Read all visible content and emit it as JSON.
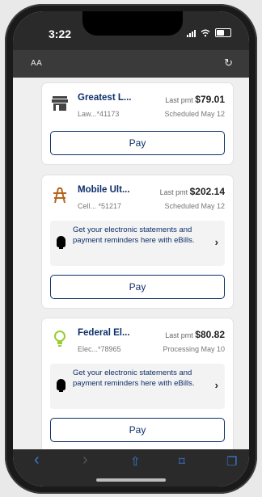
{
  "status": {
    "time": "3:22"
  },
  "browser": {
    "text_size_label": "AA",
    "reload_icon": "↻"
  },
  "colors": {
    "brand": "#0e2f6b",
    "accent": "#1a73e8"
  },
  "bills": [
    {
      "name": "Greatest L...",
      "account": "Law...*41173",
      "last_pmt_label": "Last pmt",
      "amount": "$79.01",
      "status": "Scheduled May 12",
      "pay_label": "Pay",
      "icon": "store-icon"
    },
    {
      "name": "Mobile Ult...",
      "account": "Cell... *51217",
      "last_pmt_label": "Last pmt",
      "amount": "$202.14",
      "status": "Scheduled May 12",
      "ebill": "Get your electronic statements and payment reminders here with eBills.",
      "pay_label": "Pay",
      "icon": "tower-icon"
    },
    {
      "name": "Federal El...",
      "account": "Elec...*78965",
      "last_pmt_label": "Last pmt",
      "amount": "$80.82",
      "status": "Processing May 10",
      "ebill": "Get your electronic statements and payment reminders here with eBills.",
      "pay_label": "Pay",
      "icon": "lightbulb-icon"
    }
  ],
  "toolbar": {
    "back": "‹",
    "forward": "›",
    "share": "⇧",
    "bookmarks": "⌑",
    "tabs": "❐"
  }
}
